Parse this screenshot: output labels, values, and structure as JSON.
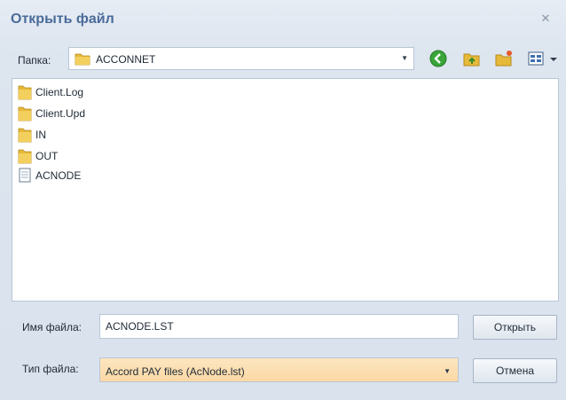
{
  "window": {
    "title": "Открыть файл",
    "close_glyph": "✕"
  },
  "folder": {
    "label": "Папка:",
    "current": "ACCONNET",
    "icon": "folder-icon"
  },
  "toolbar": {
    "back_icon": "back-arrow-icon",
    "up_icon": "folder-up-icon",
    "new_folder_icon": "new-folder-icon",
    "view_icon": "view-menu-icon"
  },
  "files": [
    {
      "name": "Client.Log",
      "type": "folder"
    },
    {
      "name": "Client.Upd",
      "type": "folder"
    },
    {
      "name": "IN",
      "type": "folder"
    },
    {
      "name": "OUT",
      "type": "folder"
    },
    {
      "name": "ACNODE",
      "type": "file",
      "selected": true
    }
  ],
  "filename": {
    "label": "Имя файла:",
    "value": "ACNODE.LST"
  },
  "filetype": {
    "label": "Тип файла:",
    "value": "Accord PAY files (AcNode.lst)"
  },
  "buttons": {
    "open": "Открыть",
    "cancel": "Отмена"
  },
  "colors": {
    "title": "#4a6b9a",
    "filetype_bg": "#fbd8a4",
    "background": "#dfe6ef"
  }
}
